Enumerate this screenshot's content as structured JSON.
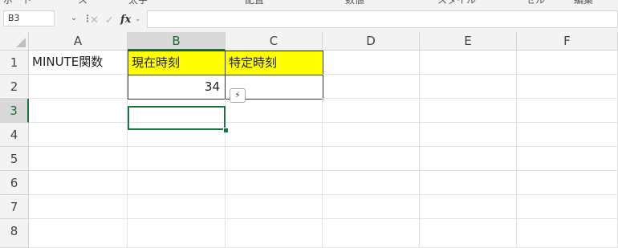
{
  "ribbon": {
    "fragments": [
      "ボード",
      "ス",
      "太宇",
      "配置",
      "数値",
      "スタイル",
      "セル",
      "編集"
    ]
  },
  "formula_bar": {
    "name_box": "B3",
    "function_symbol": "fx",
    "formula": ""
  },
  "grid": {
    "columns": [
      "A",
      "B",
      "C",
      "D",
      "E",
      "F"
    ],
    "rows": [
      "1",
      "2",
      "3",
      "4",
      "5",
      "6",
      "7",
      "8"
    ],
    "selected_column": "B",
    "selected_row": "3",
    "cells": {
      "A1": "MINUTE関数",
      "B1": "現在時刻",
      "C1": "特定時刻",
      "B2": "34"
    }
  },
  "colors": {
    "header_fill": "#ffff00",
    "selection_accent": "#1e7145"
  },
  "icons": {
    "quick_analysis": "quick-analysis-icon"
  }
}
